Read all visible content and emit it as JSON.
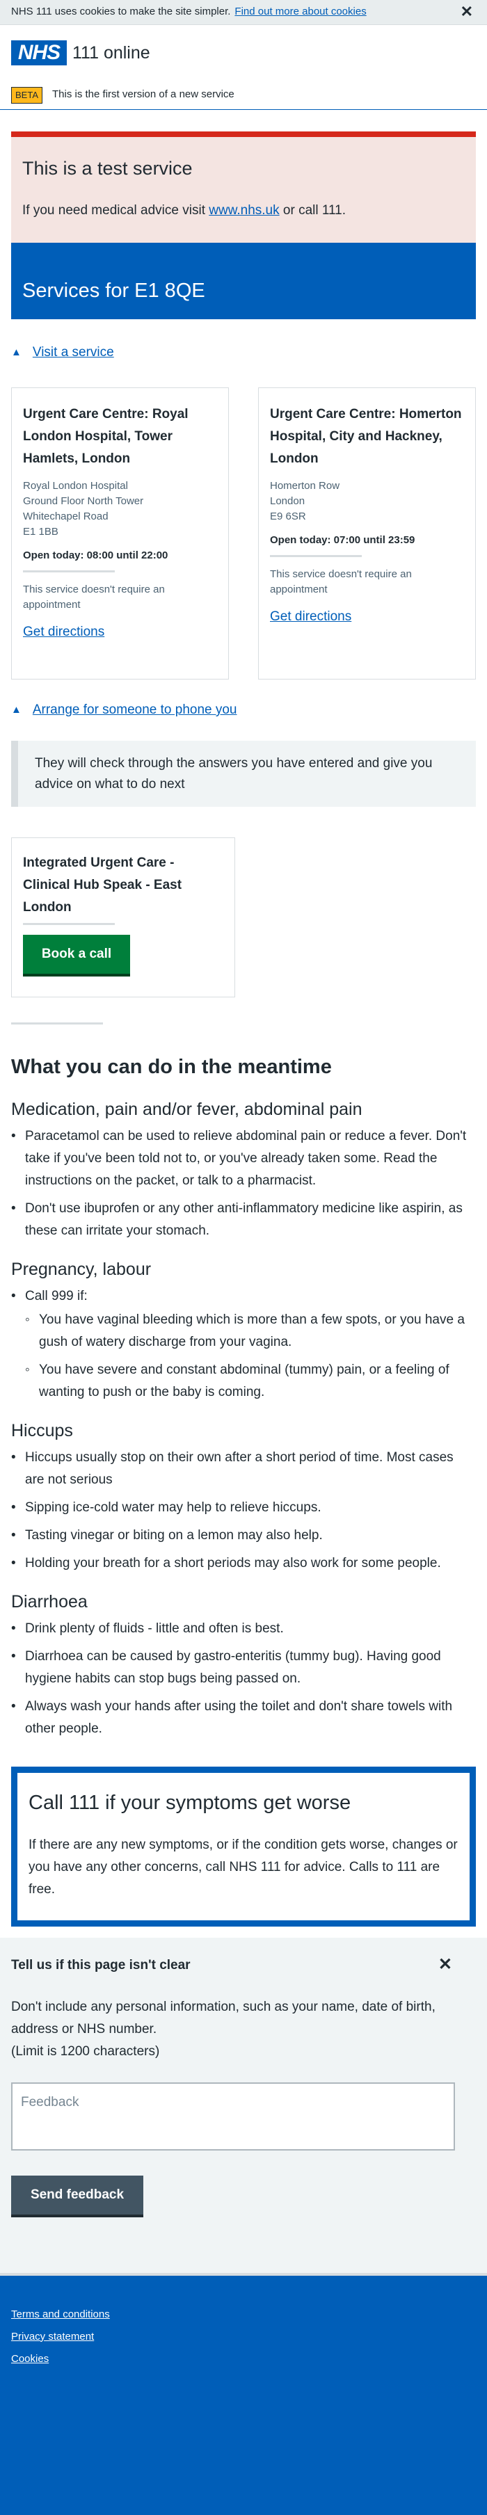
{
  "cookie": {
    "text": "NHS 111 uses cookies to make the site simpler.",
    "link": "Find out more about cookies",
    "close": "✕"
  },
  "header": {
    "logo": "NHS",
    "service": "111 online"
  },
  "phase": {
    "tag": "BETA",
    "text": "This is the first version of a new service"
  },
  "test_banner": {
    "title": "This is a test service",
    "text_before": "If you need medical advice visit ",
    "link": "www.nhs.uk",
    "text_after": " or call 111."
  },
  "services_title": "Services for E1 8QE",
  "visit": {
    "toggle": "Visit a service",
    "cards": [
      {
        "name": "Urgent Care Centre: Royal London Hospital, Tower Hamlets, London",
        "address": [
          "Royal London Hospital",
          "Ground Floor North Tower",
          "Whitechapel Road",
          "E1 1BB"
        ],
        "open": "Open today: 08:00 until 22:00",
        "note": "This service doesn't require an appointment",
        "link": "Get directions"
      },
      {
        "name": "Urgent Care Centre: Homerton Hospital, City and Hackney, London",
        "address": [
          "Homerton Row",
          "London",
          "E9 6SR"
        ],
        "open": "Open today: 07:00 until 23:59",
        "note": "This service doesn't require an appointment",
        "link": "Get directions"
      }
    ]
  },
  "phone": {
    "toggle": "Arrange for someone to phone you",
    "inset": "They will check through the answers you have entered and give you advice on what to do next",
    "card_title": "Integrated Urgent Care - Clinical Hub Speak - East London",
    "button": "Book a call"
  },
  "meantime": {
    "title": "What you can do in the meantime",
    "sections": [
      {
        "title": "Medication, pain and/or fever, abdominal pain",
        "items": [
          "Paracetamol can be used to relieve abdominal pain or reduce a fever. Don't take if you've been told not to, or you've already taken some. Read the instructions on the packet, or talk to a pharmacist.",
          "Don't use ibuprofen or any other anti-inflammatory medicine like aspirin, as these can irritate your stomach."
        ]
      },
      {
        "title": "Pregnancy, labour",
        "items": [
          "Call 999 if:"
        ],
        "subitems": [
          "You have vaginal bleeding which is more than a few spots, or you have a gush of watery discharge from your vagina.",
          "You have severe and constant abdominal (tummy) pain, or a feeling of wanting to push or the baby is coming."
        ]
      },
      {
        "title": "Hiccups",
        "items": [
          "Hiccups usually stop on their own after a short period of time. Most cases are not serious",
          "Sipping ice-cold water may help to relieve hiccups.",
          "Tasting vinegar or biting on a lemon may also help.",
          "Holding your breath for a short periods may also work for some people."
        ]
      },
      {
        "title": "Diarrhoea",
        "items": [
          "Drink plenty of fluids - little and often is best.",
          "Diarrhoea can be caused by gastro-enteritis (tummy bug). Having good hygiene habits can stop bugs being passed on.",
          "Always wash your hands after using the toilet and don't share towels with other people."
        ]
      }
    ]
  },
  "callout": {
    "title": "Call 111 if your symptoms get worse",
    "text": "If there are any new symptoms, or if the condition gets worse, changes or you have any other concerns, call NHS 111 for advice. Calls to 111 are free."
  },
  "feedback": {
    "title": "Tell us if this page isn't clear",
    "close": "✕",
    "desc": "Don't include any personal information, such as your name, date of birth, address or NHS number.",
    "limit": "(Limit is 1200 characters)",
    "placeholder": "Feedback",
    "button": "Send feedback"
  },
  "footer": {
    "links": [
      "Terms and conditions",
      "Privacy statement",
      "Cookies"
    ]
  },
  "colors": {
    "nhs_blue": "#005eb8",
    "green": "#007f3b",
    "red": "#d5281b",
    "beta": "#ffb81c"
  }
}
